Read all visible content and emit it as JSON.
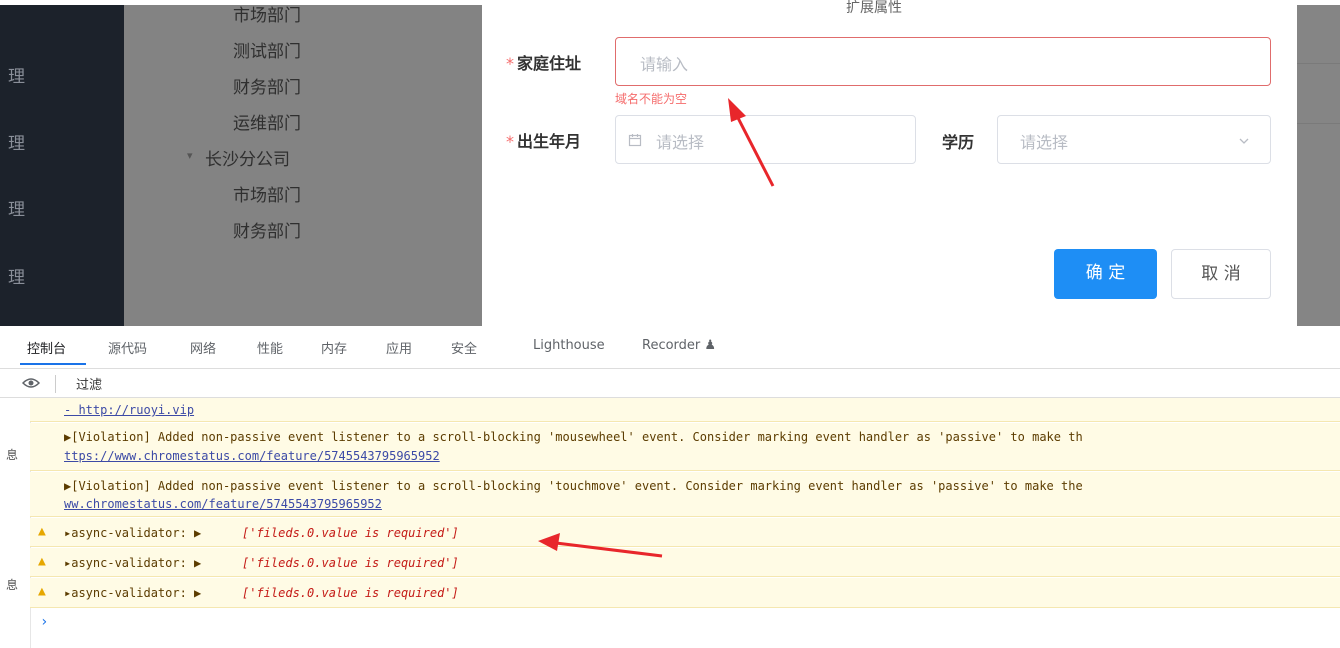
{
  "sidebar": {
    "items": [
      "理",
      "理",
      "理",
      "理"
    ]
  },
  "tree": {
    "items": [
      "市场部门",
      "测试部门",
      "财务部门",
      "运维部门",
      "长沙分公司",
      "市场部门",
      "财务部门"
    ],
    "arrow": "▾"
  },
  "dialog": {
    "partial_title": "扩展属性",
    "address_label": "家庭住址",
    "address_placeholder": "请输入",
    "address_error": "域名不能为空",
    "birth_label": "出生年月",
    "birth_placeholder": "请选择",
    "education_label": "学历",
    "education_placeholder": "请选择",
    "required_mark": "*",
    "confirm": "确 定",
    "cancel": "取 消"
  },
  "devtools": {
    "tabs": [
      "控制台",
      "源代码",
      "网络",
      "性能",
      "内存",
      "应用",
      "安全",
      "Lighthouse",
      "Recorder ♟"
    ],
    "filter_placeholder": "过滤",
    "gutter_labels": [
      "息",
      "息"
    ],
    "messages": [
      {
        "line1": "- http://ruoyi.vip"
      },
      {
        "line1": "▶[Violation] Added non-passive event listener to a scroll-blocking 'mousewheel' event. Consider marking event handler as 'passive' to make th",
        "line2": "ttps://www.chromestatus.com/feature/5745543795965952"
      },
      {
        "line1": "▶[Violation] Added non-passive event listener to a scroll-blocking 'touchmove' event. Consider marking event handler as 'passive' to make the",
        "line2": "ww.chromestatus.com/feature/5745543795965952"
      }
    ],
    "warnings": [
      {
        "prefix": "▸async-validator: ▶",
        "value": "['fileds.0.value is required']"
      },
      {
        "prefix": "▸async-validator: ▶",
        "value": "['fileds.0.value is required']"
      },
      {
        "prefix": "▸async-validator: ▶",
        "value": "['fileds.0.value is required']"
      }
    ],
    "prompt": "›"
  },
  "colors": {
    "accent": "#1e8ef5",
    "error": "#f56c6c",
    "warning_bg": "#fffbe5",
    "annotation_arrow": "#e8262b"
  }
}
